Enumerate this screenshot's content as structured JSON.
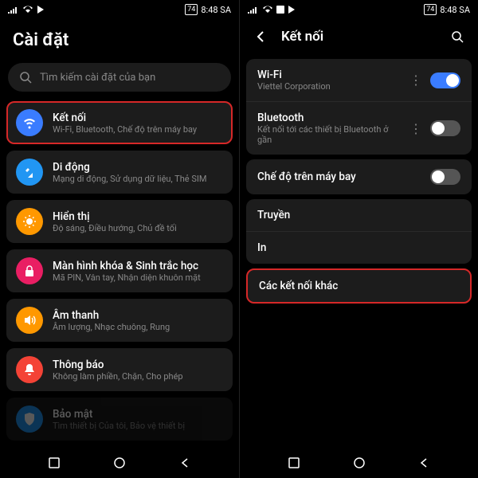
{
  "statusbar": {
    "battery": "74",
    "time": "8:48 SA"
  },
  "left": {
    "title": "Cài đặt",
    "search_placeholder": "Tìm kiếm cài đặt của bạn",
    "items": [
      {
        "icon": "wifi",
        "color": "#3a7cff",
        "title": "Kết nối",
        "sub": "Wi-Fi, Bluetooth, Chế độ trên máy bay",
        "hl": true
      },
      {
        "icon": "mobile",
        "color": "#2196f3",
        "title": "Di động",
        "sub": "Mạng di động, Sử dụng dữ liệu, Thẻ SIM"
      },
      {
        "icon": "display",
        "color": "#ff9800",
        "title": "Hiển thị",
        "sub": "Độ sáng, Điều hướng, Chủ đề tối"
      },
      {
        "icon": "lock",
        "color": "#e91e63",
        "title": "Màn hình khóa & Sinh trắc học",
        "sub": "Mã PIN, Vân tay, Nhận diện khuôn mặt"
      },
      {
        "icon": "sound",
        "color": "#ff9800",
        "title": "Âm thanh",
        "sub": "Âm lượng, Nhạc chuông, Rung"
      },
      {
        "icon": "bell",
        "color": "#f44336",
        "title": "Thông báo",
        "sub": "Không làm phiền, Chặn, Cho phép"
      },
      {
        "icon": "shield",
        "color": "#2196f3",
        "title": "Bảo mật",
        "sub": "Tìm thiết bị Của tôi, Bảo vệ thiết bị"
      }
    ]
  },
  "right": {
    "header": "Kết nối",
    "groups": [
      {
        "rows": [
          {
            "title": "Wi-Fi",
            "sub": "Viettel Corporation",
            "more": true,
            "toggle": "on"
          },
          {
            "title": "Bluetooth",
            "sub": "Kết nối tới các thiết bị Bluetooth ở gần",
            "more": true,
            "toggle": "off"
          }
        ]
      },
      {
        "rows": [
          {
            "title": "Chế độ trên máy bay",
            "toggle": "off"
          }
        ]
      },
      {
        "rows": [
          {
            "title": "Truyền"
          },
          {
            "title": "In"
          }
        ]
      },
      {
        "hl": true,
        "rows": [
          {
            "title": "Các kết nối khác"
          }
        ]
      }
    ]
  }
}
